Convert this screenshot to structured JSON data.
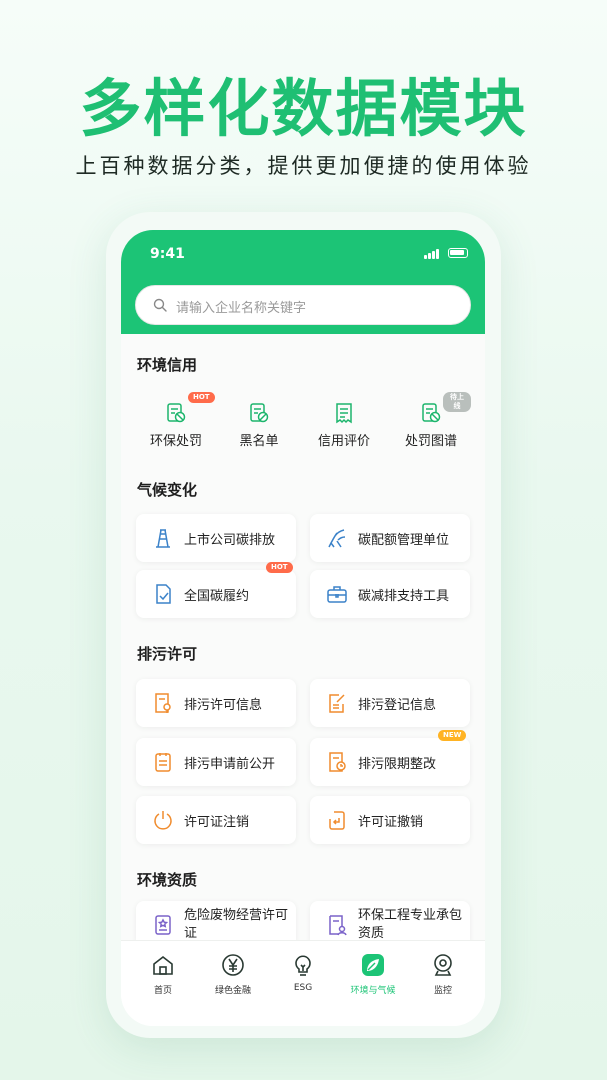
{
  "hero": {
    "title": "多样化数据模块",
    "subtitle": "上百种数据分类，提供更加便捷的使用体验"
  },
  "status_bar": {
    "time": "9:41"
  },
  "search": {
    "placeholder": "请输入企业名称关键字"
  },
  "sections": {
    "env_credit": {
      "title": "环境信用",
      "items": [
        {
          "label": "环保处罚",
          "icon": "penalty-doc-icon",
          "badge": "HOT"
        },
        {
          "label": "黑名单",
          "icon": "blacklist-doc-icon"
        },
        {
          "label": "信用评价",
          "icon": "credit-receipt-icon"
        },
        {
          "label": "处罚图谱",
          "icon": "penalty-graph-icon",
          "badge": "待上线"
        }
      ]
    },
    "climate": {
      "title": "气候变化",
      "items": [
        {
          "label": "上市公司碳排放",
          "icon": "tower-icon"
        },
        {
          "label": "碳配额管理单位",
          "icon": "factory-icon"
        },
        {
          "label": "全国碳履约",
          "icon": "check-doc-icon",
          "badge": "HOT"
        },
        {
          "label": "碳减排支持工具",
          "icon": "toolbox-icon"
        }
      ]
    },
    "discharge": {
      "title": "排污许可",
      "items": [
        {
          "label": "排污许可信息",
          "icon": "permit-doc-icon"
        },
        {
          "label": "排污登记信息",
          "icon": "edit-doc-icon"
        },
        {
          "label": "排污申请前公开",
          "icon": "clipboard-icon"
        },
        {
          "label": "排污限期整改",
          "icon": "deadline-doc-icon",
          "badge": "NEW"
        },
        {
          "label": "许可证注销",
          "icon": "power-icon"
        },
        {
          "label": "许可证撤销",
          "icon": "revoke-icon"
        }
      ]
    },
    "env_qualification": {
      "title": "环境资质",
      "items": [
        {
          "label": "危险废物经营许可证",
          "icon": "certificate-icon"
        },
        {
          "label": "环保工程专业承包资质",
          "icon": "contractor-doc-icon"
        }
      ]
    }
  },
  "tabbar": {
    "items": [
      {
        "label": "首页",
        "icon": "home-icon"
      },
      {
        "label": "绿色金融",
        "icon": "yuan-icon"
      },
      {
        "label": "ESG",
        "icon": "lightbulb-icon"
      },
      {
        "label": "环境与气候",
        "icon": "leaf-icon",
        "active": true
      },
      {
        "label": "监控",
        "icon": "camera-icon"
      }
    ]
  },
  "colors": {
    "brand_green": "#1cc476",
    "hero_green": "#1fbf73",
    "icon_green": "#1cb56c",
    "icon_blue": "#3b82c9",
    "icon_orange": "#f08c2e",
    "badge_hot": "#ff6b4a",
    "badge_new": "#ffb323"
  }
}
